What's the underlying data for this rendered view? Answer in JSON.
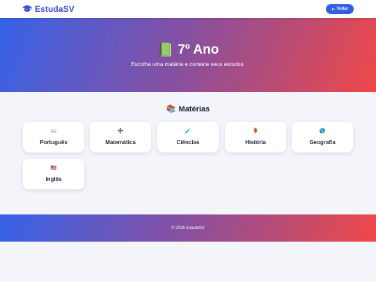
{
  "navbar": {
    "brand": "EstudaSV",
    "back_label": "Voltar",
    "back_arrow": "⇠"
  },
  "hero": {
    "emoji": "📗",
    "title": "7º Ano",
    "subtitle": "Escolha uma matéria e comece seus estudos."
  },
  "section": {
    "emoji": "📚",
    "title": "Matérias"
  },
  "subjects": [
    {
      "label": "Português",
      "icon": "book-icon",
      "glyph": "📖"
    },
    {
      "label": "Matemática",
      "icon": "math-icon",
      "glyph": "➗"
    },
    {
      "label": "Ciências",
      "icon": "test-tube-icon",
      "glyph": "🧪"
    },
    {
      "label": "História",
      "icon": "scroll-icon",
      "glyph": "🏺"
    },
    {
      "label": "Geografia",
      "icon": "globe-icon",
      "glyph": "🌎"
    },
    {
      "label": "Inglês",
      "icon": "us-flag-icon",
      "glyph": "🇺🇸"
    }
  ],
  "footer": {
    "text": "© 2026 EstudaSV"
  },
  "colors": {
    "accent": "#2f5fe3",
    "brand": "#3a4fd6",
    "gradient_start": "#3563e9",
    "gradient_end": "#ef4848"
  }
}
